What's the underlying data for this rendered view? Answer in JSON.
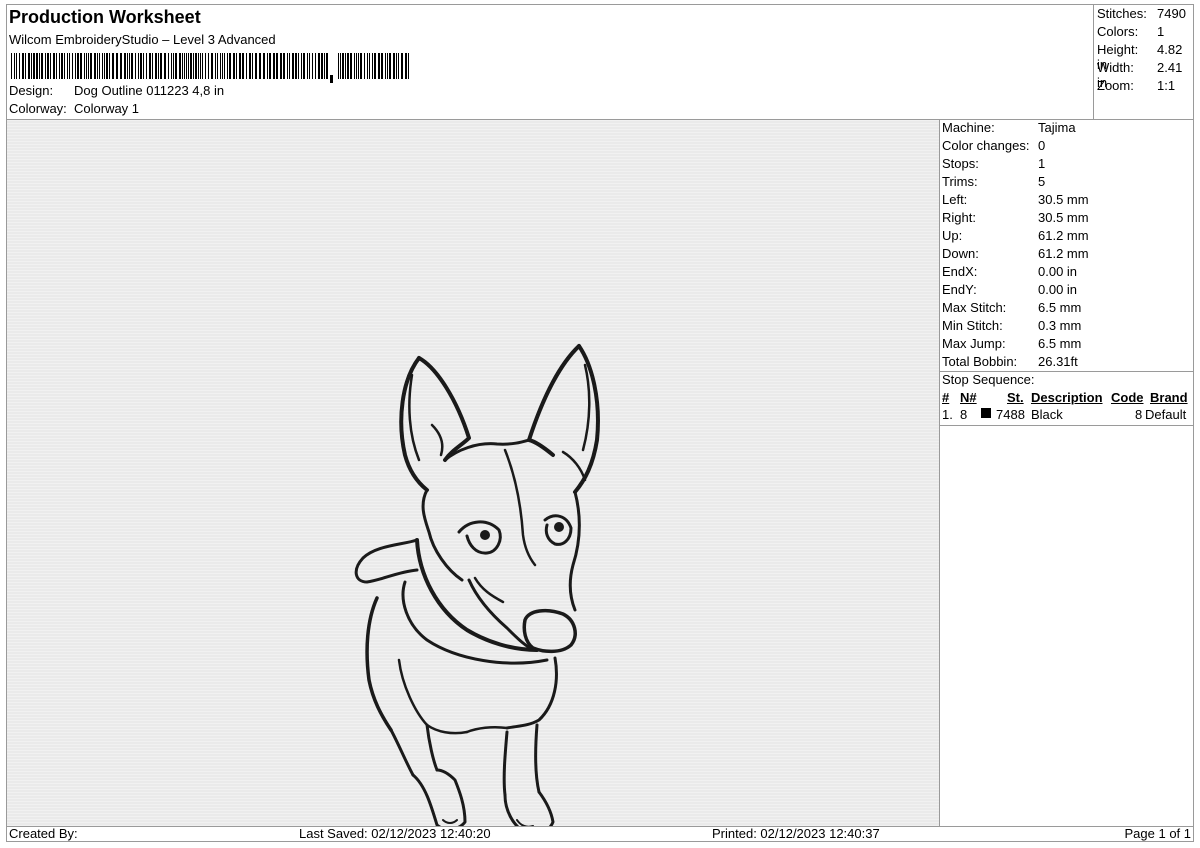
{
  "header": {
    "title": "Production Worksheet",
    "subtitle": "Wilcom EmbroideryStudio – Level 3 Advanced",
    "design_label": "Design:",
    "design_value": "Dog Outline 011223  4,8 in",
    "colorway_label": "Colorway:",
    "colorway_value": "Colorway 1"
  },
  "stats": [
    {
      "label": "Stitches:",
      "value": "7490"
    },
    {
      "label": "Colors:",
      "value": "1"
    },
    {
      "label": "Height:",
      "value": "4.82 in"
    },
    {
      "label": "Width:",
      "value": "2.41 in"
    },
    {
      "label": "Zoom:",
      "value": "1:1"
    }
  ],
  "machine_info": [
    {
      "label": "Machine:",
      "value": "Tajima"
    },
    {
      "label": "Color changes:",
      "value": "0"
    },
    {
      "label": "Stops:",
      "value": "1"
    },
    {
      "label": "Trims:",
      "value": "5"
    },
    {
      "label": "Left:",
      "value": "30.5 mm"
    },
    {
      "label": "Right:",
      "value": "30.5 mm"
    },
    {
      "label": "Up:",
      "value": "61.2 mm"
    },
    {
      "label": "Down:",
      "value": "61.2 mm"
    },
    {
      "label": "EndX:",
      "value": "0.00 in"
    },
    {
      "label": "EndY:",
      "value": "0.00 in"
    },
    {
      "label": "Max Stitch:",
      "value": "6.5 mm"
    },
    {
      "label": "Min Stitch:",
      "value": "0.3 mm"
    },
    {
      "label": "Max Jump:",
      "value": "6.5 mm"
    },
    {
      "label": "Total Bobbin:",
      "value": "26.31ft"
    }
  ],
  "stop_sequence": {
    "title": "Stop Sequence:",
    "headers": {
      "num": "#",
      "needle": "N#",
      "stitches": "St.",
      "description": "Description",
      "code": "Code",
      "brand": "Brand"
    },
    "row": {
      "num": "1.",
      "needle": "8",
      "swatch_color": "#000000",
      "stitches": "7488",
      "description": "Black",
      "code": "8",
      "brand": "Default"
    }
  },
  "footer": {
    "created_by": "Created By:",
    "last_saved": "Last Saved: 02/12/2023 12:40:20",
    "printed": "Printed: 02/12/2023 12:40:37",
    "page": "Page 1 of 1"
  },
  "design_preview": {
    "thread_color": "#1a1a1a",
    "background_color": "#eaeaea",
    "icon": "dog-outline-embroidery"
  }
}
